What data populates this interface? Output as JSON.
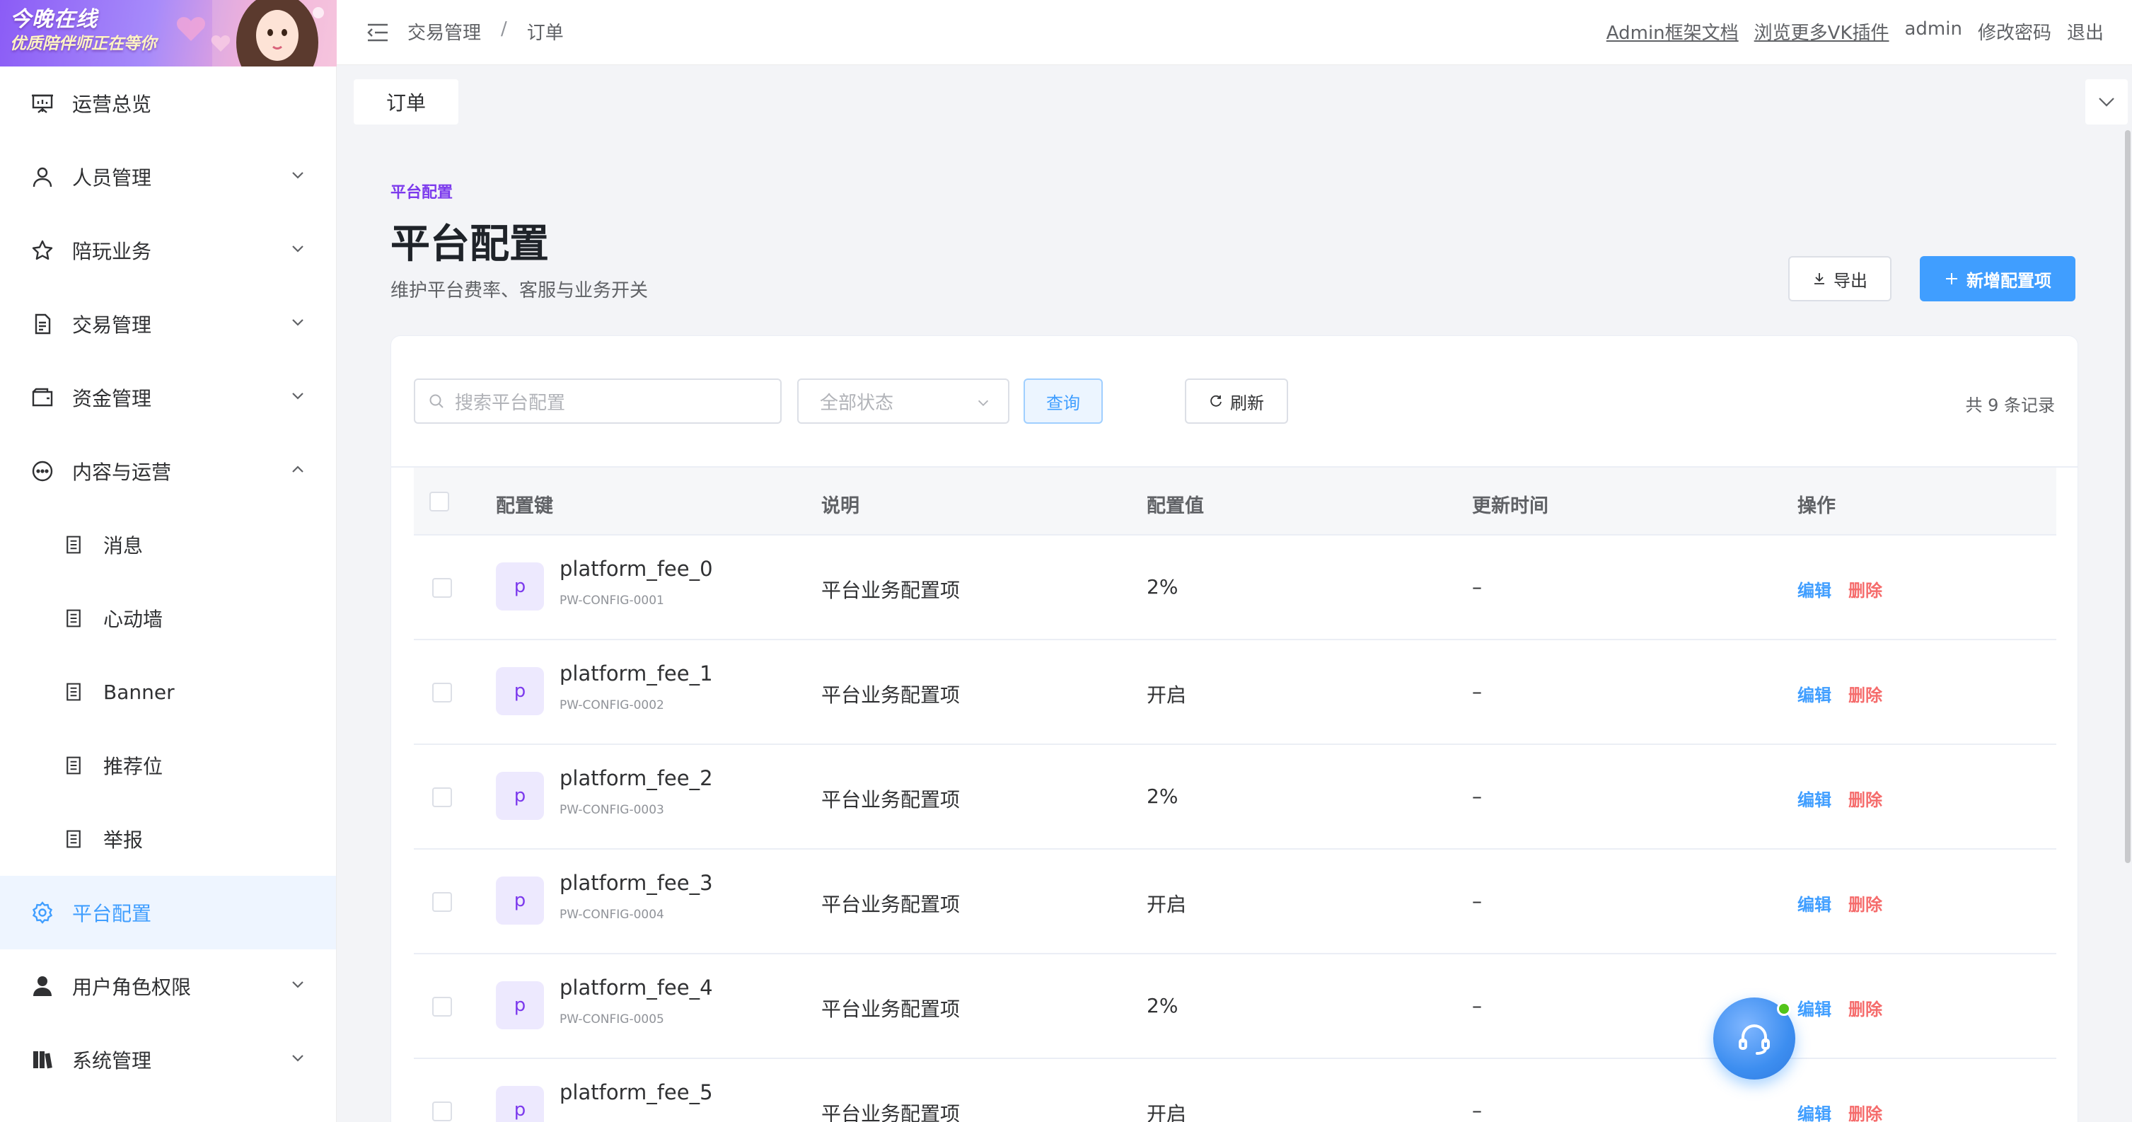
{
  "banner": {
    "title": "今晚在线",
    "subtitle": "优质陪伴师正在等你"
  },
  "sidebar": {
    "items": [
      {
        "label": "运营总览"
      },
      {
        "label": "人员管理"
      },
      {
        "label": "陪玩业务"
      },
      {
        "label": "交易管理"
      },
      {
        "label": "资金管理"
      },
      {
        "label": "内容与运营"
      },
      {
        "label": "消息"
      },
      {
        "label": "心动墙"
      },
      {
        "label": "Banner"
      },
      {
        "label": "推荐位"
      },
      {
        "label": "举报"
      },
      {
        "label": "平台配置"
      },
      {
        "label": "用户角色权限"
      },
      {
        "label": "系统管理"
      }
    ],
    "active_color": "#409eff"
  },
  "header": {
    "breadcrumb": [
      "交易管理",
      "订单"
    ],
    "breadcrumb_sep": "/",
    "links": [
      "Admin框架文档",
      "浏览更多VK插件",
      "admin",
      "修改密码",
      "退出"
    ]
  },
  "tabs": {
    "current": "订单"
  },
  "page": {
    "eyebrow": "平台配置",
    "title": "平台配置",
    "description": "维护平台费率、客服与业务开关",
    "export_label": "导出",
    "add_label": "新增配置项"
  },
  "filters": {
    "search_placeholder": "搜索平台配置",
    "status_placeholder": "全部状态",
    "query_label": "查询",
    "refresh_label": "刷新",
    "record_count": "共 9 条记录"
  },
  "table": {
    "columns": [
      "配置键",
      "说明",
      "配置值",
      "更新时间",
      "操作"
    ],
    "edit_label": "编辑",
    "delete_label": "删除",
    "rows": [
      {
        "avatar": "p",
        "key": "platform_fee_0",
        "code": "PW-CONFIG-0001",
        "desc": "平台业务配置项",
        "value": "2%",
        "updated": "–"
      },
      {
        "avatar": "p",
        "key": "platform_fee_1",
        "code": "PW-CONFIG-0002",
        "desc": "平台业务配置项",
        "value": "开启",
        "updated": "–"
      },
      {
        "avatar": "p",
        "key": "platform_fee_2",
        "code": "PW-CONFIG-0003",
        "desc": "平台业务配置项",
        "value": "2%",
        "updated": "–"
      },
      {
        "avatar": "p",
        "key": "platform_fee_3",
        "code": "PW-CONFIG-0004",
        "desc": "平台业务配置项",
        "value": "开启",
        "updated": "–"
      },
      {
        "avatar": "p",
        "key": "platform_fee_4",
        "code": "PW-CONFIG-0005",
        "desc": "平台业务配置项",
        "value": "2%",
        "updated": "–"
      },
      {
        "avatar": "p",
        "key": "platform_fee_5",
        "code": "",
        "desc": "平台业务配置项",
        "value": "开启",
        "updated": "–"
      }
    ]
  },
  "colors": {
    "primary": "#409eff",
    "accent_purple": "#7c3aed",
    "danger": "#f56c6c"
  }
}
